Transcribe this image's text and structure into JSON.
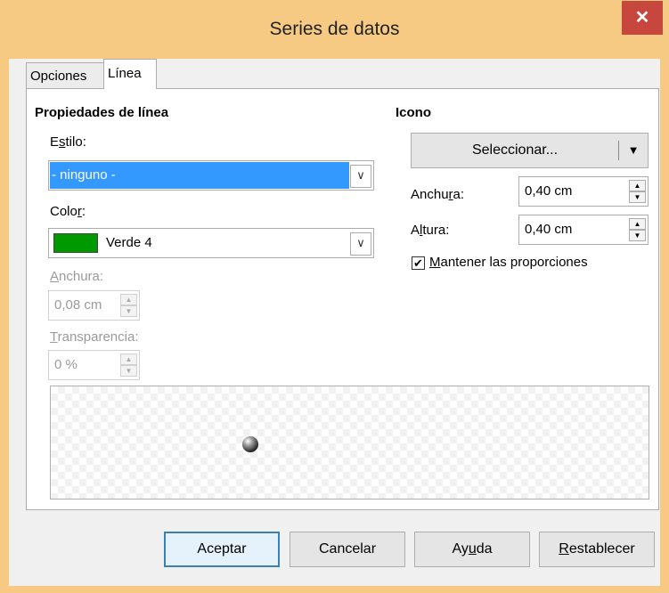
{
  "window": {
    "title": "Series de datos",
    "close_glyph": "✕",
    "frame_color": "#f7ca83"
  },
  "tabs": [
    {
      "label": "Opciones"
    },
    {
      "label": "Línea"
    }
  ],
  "line_properties": {
    "heading": "Propiedades de línea",
    "style": {
      "label_pre": "E",
      "label_u": "s",
      "label_post": "tilo:",
      "value": "- ninguno -"
    },
    "color": {
      "label_pre": "Colo",
      "label_u": "r",
      "label_post": ":",
      "value": "Verde 4",
      "swatch": "#009900"
    },
    "width": {
      "label_pre": "",
      "label_u": "A",
      "label_post": "nchura:",
      "value": "0,08 cm"
    },
    "transparency": {
      "label_pre": "",
      "label_u": "T",
      "label_post": "ransparencia:",
      "value": "0 %"
    }
  },
  "icon": {
    "heading": "Icono",
    "select_label": "Seleccionar...",
    "width": {
      "label_pre": "Anchu",
      "label_u": "r",
      "label_post": "a:",
      "value": "0,40 cm"
    },
    "height": {
      "label_pre": "A",
      "label_u": "l",
      "label_post": "tura:",
      "value": "0,40 cm"
    },
    "keep_ratio": {
      "label_pre": "",
      "label_u": "M",
      "label_post": "antener las proporciones",
      "checked": true
    }
  },
  "buttons": {
    "ok": "Aceptar",
    "cancel": "Cancelar",
    "help_pre": "Ay",
    "help_u": "u",
    "help_post": "da",
    "reset_pre": "",
    "reset_u": "R",
    "reset_post": "establecer"
  },
  "icons": {
    "close": "close-icon",
    "dropdown": "chevron-down-icon",
    "spin_up": "spin-up-icon",
    "spin_down": "spin-down-icon",
    "checkbox": "checkbox-icon",
    "preview_symbol": "sphere-symbol-icon"
  }
}
